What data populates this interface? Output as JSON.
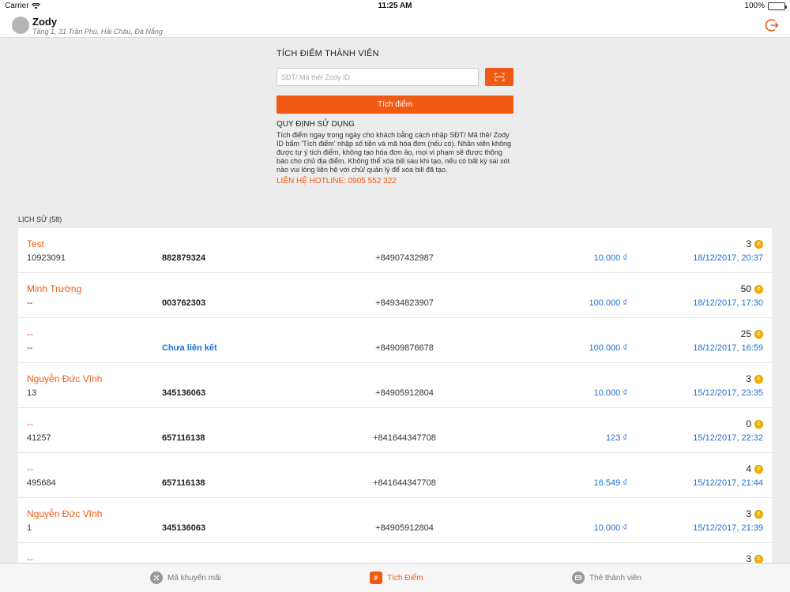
{
  "status_bar": {
    "carrier": "Carrier",
    "time": "11:25 AM",
    "battery": "100%"
  },
  "header": {
    "store_name": "Zody",
    "store_address": "Tầng 1, 31 Trần Phú, Hải Châu, Đà Nẵng",
    "logout_icon": "logout-icon"
  },
  "form": {
    "title": "TÍCH ĐIỂM THÀNH VIÊN",
    "input_value": "",
    "input_placeholder": "SĐT/ Mã thẻ/ Zody ID",
    "scan_icon": "qr-scan-icon",
    "submit_label": "Tích điểm",
    "rules_title": "QUY ĐỊNH SỬ DỤNG",
    "rules_text": " Tích điểm ngay trong ngày cho khách bằng cách nhập SĐT/ Mã thẻ/ Zody ID bấm 'Tích điểm' nhập số tiền và mã hóa đơn (nếu có). Nhân viên không được tự ý tích điểm, không tạo hóa đơn ảo, mọi vi phạm sẽ được thông báo cho chủ địa điểm. Không thể xóa bill sau khi tạo, nếu có bất kỳ sai xót nào vui lòng liên hệ với chủ/ quản lý để xóa bill đã tạo.",
    "hotline": "LIÊN HỆ HOTLINE: 0905 552 322"
  },
  "history": {
    "label": "LỊCH SỬ (58)",
    "rows": [
      {
        "name": "Test",
        "code": "10923091",
        "card": "882879324",
        "card_linked": true,
        "phone": "+84907432987",
        "amount": "10.000 ₫",
        "points": "3",
        "date": "18/12/2017, 20:37"
      },
      {
        "name": "Minh Trường",
        "code": "--",
        "card": "003762303",
        "card_linked": true,
        "phone": "+84934823907",
        "amount": "100.000 ₫",
        "points": "50",
        "date": "18/12/2017, 17:30"
      },
      {
        "name": "--",
        "code": "--",
        "card": "Chưa liên kết",
        "card_linked": false,
        "phone": "+84909876678",
        "amount": "100.000 ₫",
        "points": "25",
        "date": "18/12/2017, 16:59"
      },
      {
        "name": "Nguyễn Đức Vĩnh",
        "code": "13",
        "card": "345136063",
        "card_linked": true,
        "phone": "+84905912804",
        "amount": "10.000 ₫",
        "points": "3",
        "date": "15/12/2017, 23:35"
      },
      {
        "name": "--",
        "code": "41257",
        "card": "657116138",
        "card_linked": true,
        "phone": "+841644347708",
        "amount": "123 ₫",
        "points": "0",
        "date": "15/12/2017, 22:32"
      },
      {
        "name": "--",
        "code": "495684",
        "card": "657116138",
        "card_linked": true,
        "phone": "+841644347708",
        "amount": "16.549 ₫",
        "points": "4",
        "date": "15/12/2017, 21:44"
      },
      {
        "name": "Nguyễn Đức Vĩnh",
        "code": "1",
        "card": "345136063",
        "card_linked": true,
        "phone": "+84905912804",
        "amount": "10.000 ₫",
        "points": "3",
        "date": "15/12/2017, 21:39"
      },
      {
        "name": "--",
        "code": "",
        "card": "",
        "card_linked": true,
        "phone": "",
        "amount": "",
        "points": "3",
        "date": ""
      }
    ]
  },
  "tabs": [
    {
      "label": "Mã khuyến mãi",
      "icon": "gear-badge-icon",
      "active": false
    },
    {
      "label": "Tích Điểm",
      "icon": "receipt-icon",
      "active": true
    },
    {
      "label": "Thẻ thành viên",
      "icon": "card-icon",
      "active": false
    }
  ],
  "colors": {
    "accent": "#f05a15",
    "link": "#1e6fd6",
    "coin": "#f5b400"
  }
}
